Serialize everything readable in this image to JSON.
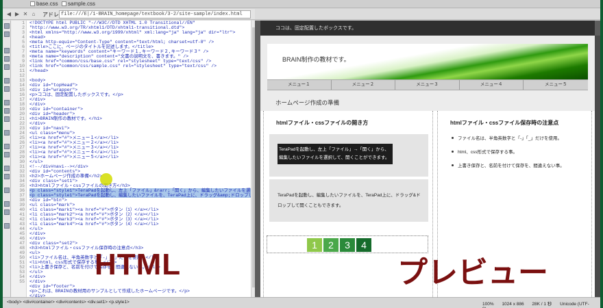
{
  "tabs": [
    "base.css",
    "sample.css"
  ],
  "address": {
    "label": "アドレス",
    "url": "file:///E|/1-BRAIN_homepage/textbook/3-2/site-sample/index.html"
  },
  "code": {
    "line_numbers": [
      "1",
      "2",
      "3",
      "4",
      "5",
      "6",
      "7",
      "8",
      "9",
      "10",
      "11",
      "12",
      "13",
      "14",
      "15",
      "16",
      "17",
      "18",
      "19",
      "20",
      "21",
      "22",
      "23",
      "24",
      "25",
      "26",
      "27",
      "28",
      "29",
      "30",
      "31",
      "32",
      "33",
      "34",
      "35",
      "36",
      "37",
      "38",
      "39",
      "40",
      "41",
      "42",
      "43",
      "44",
      "45",
      "46",
      "47",
      "48",
      "49",
      "50",
      "51",
      "52",
      "53",
      "54",
      "55"
    ],
    "lines": [
      "<!DOCTYPE html PUBLIC \"-//W3C//DTD XHTML 1.0 Transitional//EN\"",
      "\"http://www.w3.org/TR/xhtml1/DTD/xhtml1-transitional.dtd\">",
      "<html xmlns=\"http://www.w3.org/1999/xhtml\" xml:lang=\"ja\" lang=\"ja\" dir=\"ltr\">",
      "<head>",
      "<meta http-equiv=\"Content-Type\" content=\"text/html; charset=utf-8\" />",
      "<title>ここに、ページのタイトルを記述します。</title>",
      "<meta name=\"keywords\" content=\"キーワード１,キーワード２,キーワード３\" />",
      "<meta name=\"description\" content=\"文書の説明文を、書きます。\" />",
      "<link href=\"common/css/base.css\" rel=\"stylesheet\" type=\"text/css\" />",
      "<link href=\"common/css/sample.css\" rel=\"stylesheet\" type=\"text/css\" />",
      "</head>",
      "",
      "<body>",
      "<div id=\"topHead\">",
      "  <div id=\"wrapper\">",
      "    <p>ココは、固定配置したボックスです。</p>",
      "  </div>",
      "</div>",
      "<div id=\"container\">",
      "  <div id=\"header\">",
      "    <h1>BRAIN制作の教材です。</h1>",
      "  </div>",
      "  <div id=\"navi\">",
      "    <ul class=\"menu\">",
      "      <li><a href=\"#\">メニュー１</a></li>",
      "      <li><a href=\"#\">メニュー２</a></li>",
      "      <li><a href=\"#\">メニュー３</a></li>",
      "      <li><a href=\"#\">メニュー４</a></li>",
      "      <li><a href=\"#\">メニュー５</a></li>",
      "    </ul>",
      "    <!--/div#navi--></div>",
      "  <div id=\"contents\">",
      "    <h2>ホームページ作成の準備</h2>",
      "    <div class=\"set1\">",
      "      <h3>htmlファイル・cssファイルの開き方</h3>",
      "      <p class=\"style1\">TeraPadを起動し、左上「ファイル」&rarr;「開く」から、編集したいファイルを選択して、開くことができます。</p>",
      "      <p class=\"style1\">TeraPadを起動し、編集したいファイルを、TeraPad上に、ドラッグ&amp;ドロップして開くこともできます。</p>",
      "      <div id=\"btn\">",
      "        <ul class=\"mark\">",
      "          <li class=\"mark1\"><a href=\"#\">ボタン（1）</a></li>",
      "          <li class=\"mark2\"><a href=\"#\">ボタン（2）</a></li>",
      "          <li class=\"mark3\"><a href=\"#\">ボタン（3）</a></li>",
      "          <li class=\"mark4\"><a href=\"#\">ボタン（4）</a></li>",
      "        </ul>",
      "      </div>",
      "    </div>",
      "    <div class=\"set2\">",
      "      <h3>htmlファイル・cssファイル保存時の注意点</h3>",
      "      <ul>",
      "        <li>ファイル名は、半角英数字と「-」「_」だけを使用。</li>",
      "        <li>html、css形式で保存する事。</li>",
      "        <li>上書き保存と、名前を付けて保存を、間違えない事。</li>",
      "      </ul>",
      "    </div>",
      "  </div>",
      "  <div id=\"footer\">",
      "    <p>これは、BRAINの教材用のサンプルとして作成したホームページです。</p>",
      "  </div>",
      "</div>",
      "</body>",
      "</html>"
    ]
  },
  "preview": {
    "topbar_text": "ココは、固定配置したボックスです。",
    "site_title": "BRAIN制作の教材です。",
    "menu": [
      "メニュー１",
      "メニュー２",
      "メニュー３",
      "メニュー４",
      "メニュー５"
    ],
    "h2": "ホームページ作成の準備",
    "set1_h3": "htmlファイル・cssファイルの開き方",
    "style1_text1": "TeraPadを起動し、左上「ファイル」→「開く」から、編集したいファイルを選択して、開くことができます。",
    "style1_text2": "TeraPadを起動し、編集したいファイルを、TeraPad上に、ドラッグ&ドロップして開くこともできます。",
    "buttons": [
      "1",
      "2",
      "3",
      "4"
    ],
    "button_colors": [
      "#8fc84a",
      "#4aa84a",
      "#2a8a3a",
      "#156b2b"
    ],
    "set2_h3": "htmlファイル・cssファイル保存時の注意点",
    "set2_items": [
      "ファイル名は、半角英数字と「-」「_」だけを使用。",
      "html、css形式で保存する事。",
      "上書き保存と、名前を付けて保存を、間違えない事。"
    ]
  },
  "labels": {
    "html": "HTML",
    "preview": "プレビュー"
  },
  "status": {
    "path": "<body> <div#container> <div#contents> <div.set1> <p.style1>",
    "zoom": "100%",
    "size": "1024 x 886",
    "weight": "28K / 1 秒",
    "encoding": "Unicode (UTF-8)"
  }
}
